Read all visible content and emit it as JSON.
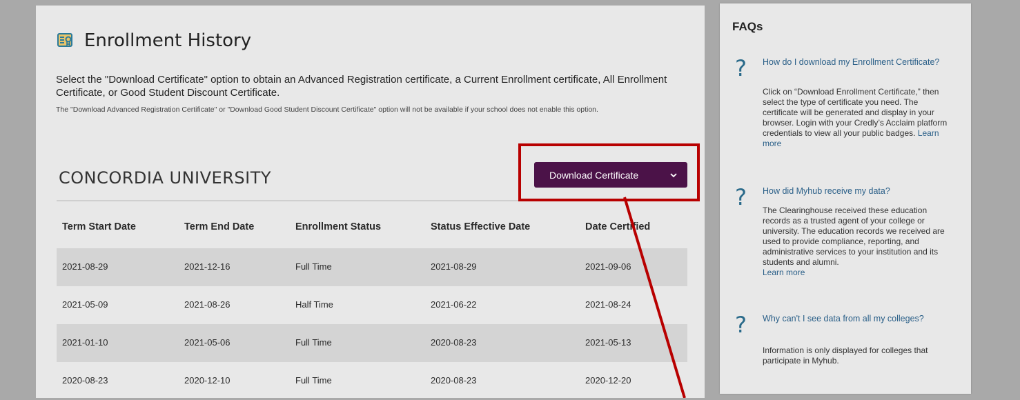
{
  "page": {
    "title": "Enrollment History",
    "intro": "Select the \"Download Certificate\" option to obtain an Advanced Registration certificate, a Current Enrollment certificate, All Enrollment Certificate, or Good Student Discount Certificate.",
    "note": "The \"Download Advanced Registration Certificate\" or \"Download Good Student Discount Certificate\" option will not be available if your school does not enable this option."
  },
  "school": {
    "name": "CONCORDIA UNIVERSITY",
    "download_label": "Download Certificate"
  },
  "table": {
    "headers": [
      "Term Start Date",
      "Term End Date",
      "Enrollment Status",
      "Status Effective Date",
      "Date Certified"
    ],
    "rows": [
      [
        "2021-08-29",
        "2021-12-16",
        "Full Time",
        "2021-08-29",
        "2021-09-06"
      ],
      [
        "2021-05-09",
        "2021-08-26",
        "Half Time",
        "2021-06-22",
        "2021-08-24"
      ],
      [
        "2021-01-10",
        "2021-05-06",
        "Full Time",
        "2020-08-23",
        "2021-05-13"
      ],
      [
        "2020-08-23",
        "2020-12-10",
        "Full Time",
        "2020-08-23",
        "2020-12-20"
      ]
    ]
  },
  "faqs": {
    "title": "FAQs",
    "items": [
      {
        "question": "How do I download my Enrollment Certificate?",
        "answer": "Click on “Download Enrollment Certificate,” then select the type of certificate you need. The certificate will be generated and display in your browser. Login with your Credly’s Acclaim platform credentials to view all your public badges.",
        "link": "Learn more"
      },
      {
        "question": "How did Myhub receive my data?",
        "answer": "The Clearinghouse received these education records as a trusted agent of your college or university. The education records we received are used to provide compliance, reporting, and administrative services to your institution and its students and alumni.",
        "link": "Learn more"
      },
      {
        "question": "Why can't I see data from all my colleges?",
        "answer": "Information is only displayed for colleges that participate in Myhub.",
        "link": ""
      }
    ]
  },
  "icons": {
    "title": "certificate-icon",
    "dropdown": "chevron-down-icon",
    "faq": "question-mark-icon"
  },
  "colors": {
    "button": "#4b1248",
    "highlight": "#b80000",
    "link": "#2a5f88"
  }
}
